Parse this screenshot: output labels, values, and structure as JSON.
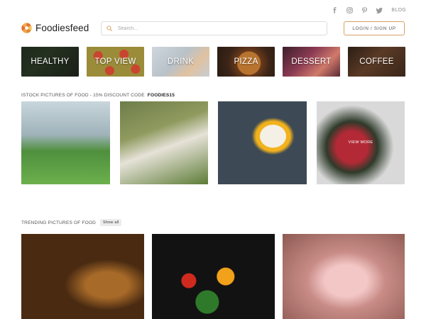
{
  "header": {
    "social": {
      "icons": [
        "facebook-icon",
        "instagram-icon",
        "pinterest-icon",
        "twitter-icon"
      ],
      "blog_label": "BLOG"
    },
    "logo_text": "Foodiesfeed",
    "search": {
      "placeholder": "Search...",
      "value": ""
    },
    "login_label": "LOGIN / SIGN UP",
    "accent_color": "#d6a063"
  },
  "categories": [
    {
      "label": "HEALTHY"
    },
    {
      "label": "TOP VIEW"
    },
    {
      "label": "DRINK"
    },
    {
      "label": "PIZZA"
    },
    {
      "label": "DESSERT"
    },
    {
      "label": "COFFEE"
    }
  ],
  "istock": {
    "heading": "ISTOCK PICTURES OF FOOD - 15% DISCOUNT CODE",
    "code": "FOODIES15",
    "view_more_label": "VIEW MORE"
  },
  "trending": {
    "heading": "TRENDING PICTURES OF FOOD",
    "show_all_label": "Show all"
  }
}
